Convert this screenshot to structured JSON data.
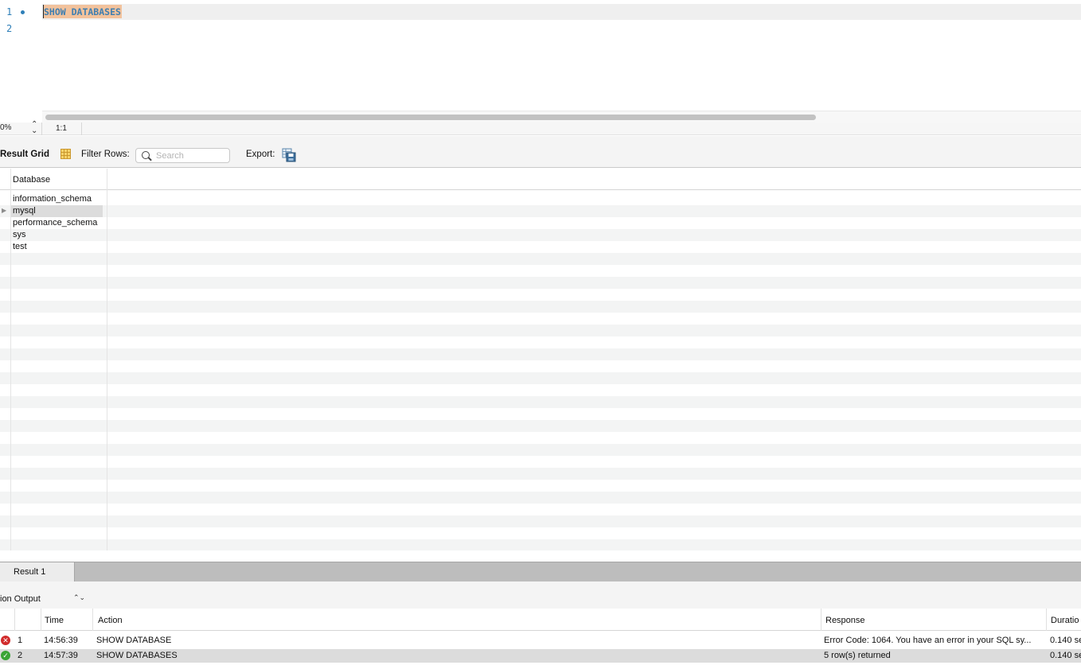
{
  "editor": {
    "line_numbers": [
      "1",
      "2"
    ],
    "sql": "SHOW DATABASES"
  },
  "statusbar": {
    "zoom": "0%",
    "cursor_position": "1:1"
  },
  "result_toolbar": {
    "result_grid_label": "Result Grid",
    "filter_rows_label": "Filter Rows:",
    "search_placeholder": "Search",
    "export_label": "Export:"
  },
  "grid": {
    "columns": [
      "Database"
    ],
    "rows": [
      "information_schema",
      "mysql",
      "performance_schema",
      "sys",
      "test"
    ],
    "selected_row": "mysql"
  },
  "result_tabs": [
    {
      "label": "Result 1",
      "active": true
    }
  ],
  "output": {
    "selector_label": "ion Output",
    "columns": {
      "time": "Time",
      "action": "Action",
      "response": "Response",
      "duration": "Duratio"
    },
    "rows": [
      {
        "status": "error",
        "index": "1",
        "time": "14:56:39",
        "action": "SHOW DATABASE",
        "response": "Error Code: 1064. You have an error in your SQL sy...",
        "duration": "0.140 se"
      },
      {
        "status": "success",
        "index": "2",
        "time": "14:57:39",
        "action": "SHOW DATABASES",
        "response": "5 row(s) returned",
        "duration": "0.140 se"
      }
    ]
  },
  "colors": {
    "keyword_text": "#3f7fb1",
    "selection_highlight": "#f2c29c",
    "line_number": "#2e7fb8",
    "error": "#d12b2b",
    "success": "#3aa435"
  }
}
